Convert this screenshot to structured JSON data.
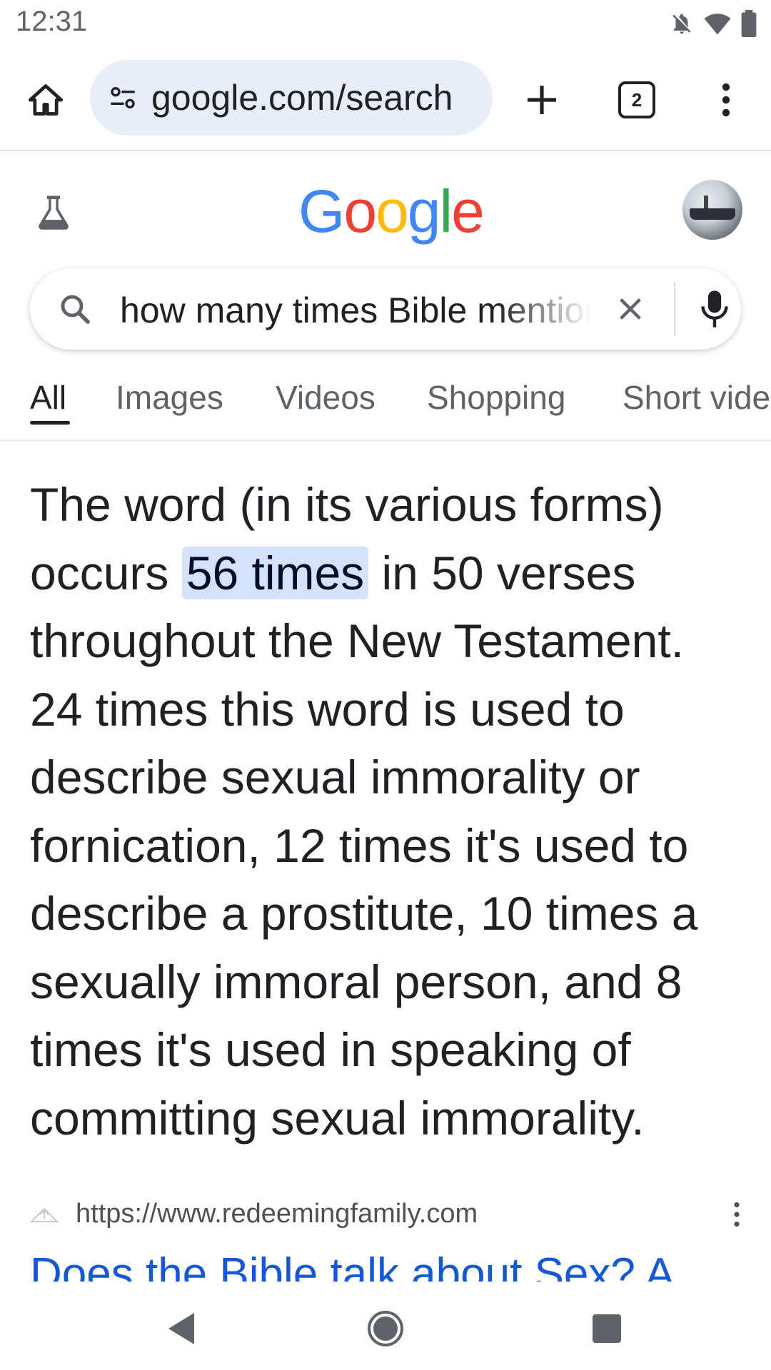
{
  "status_bar": {
    "time": "12:31"
  },
  "browser": {
    "url": "google.com/search",
    "tab_count": "2"
  },
  "google": {
    "logo_letters": [
      "G",
      "o",
      "o",
      "g",
      "l",
      "e"
    ],
    "logo_colors": [
      "#4285F4",
      "#EA4335",
      "#FBBC05",
      "#4285F4",
      "#34A853",
      "#EA4335"
    ]
  },
  "search": {
    "query": "how many times Bible mentions"
  },
  "tabs": [
    {
      "label": "All"
    },
    {
      "label": "Images"
    },
    {
      "label": "Videos"
    },
    {
      "label": "Shopping"
    },
    {
      "label": "Short videos"
    }
  ],
  "snippet": {
    "before": "The word (in its various forms) occurs ",
    "highlight": "56 times",
    "after": " in 50 verses throughout the New Testament. 24 times this word is used to describe sexual immorality or fornication, 12 times it's used to describe a prostitute, 10 times a sexually immoral person, and 8 times it's used in speaking of committing sexual immorality."
  },
  "source": {
    "url": "https://www.redeemingfamily.com",
    "title": "Does the Bible talk about Sex? A"
  },
  "colors": {
    "accent": "#1558d6",
    "highlight_bg": "#d3e3fd",
    "url_bar_bg": "#e8edf7"
  }
}
